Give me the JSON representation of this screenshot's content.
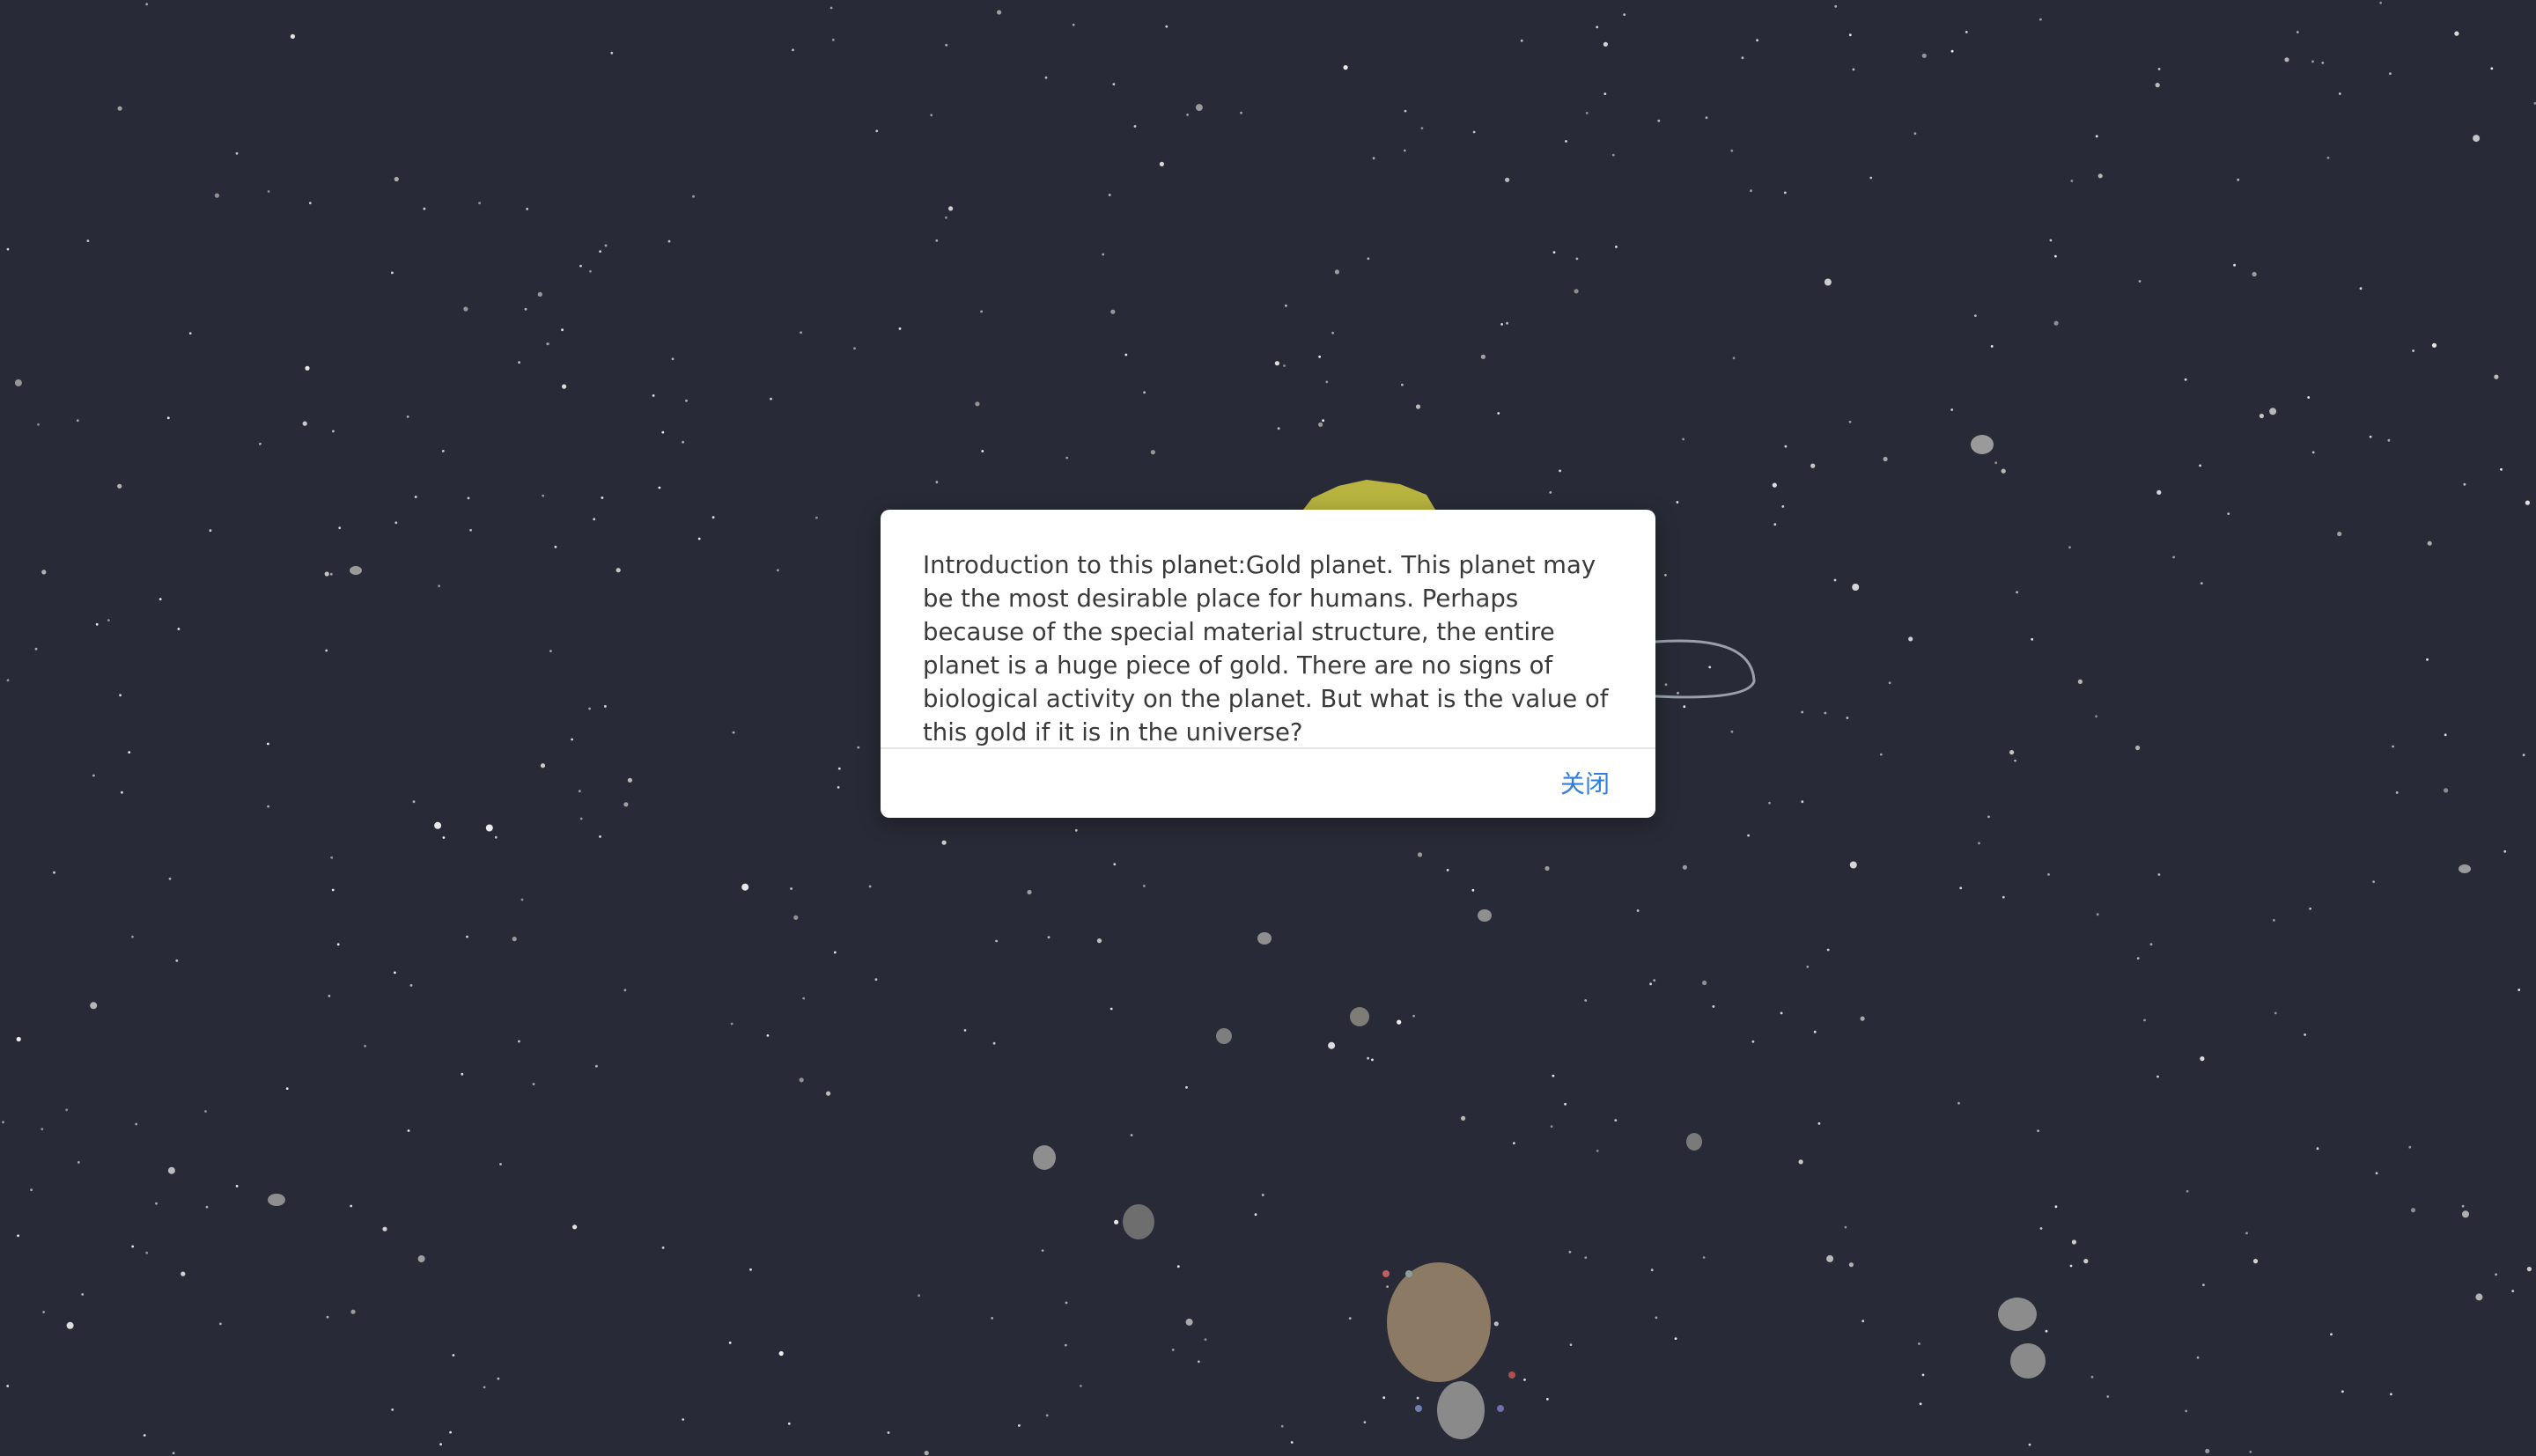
{
  "dialog": {
    "body_text": "Introduction to this planet:Gold planet. This planet may be the most desirable place for humans. Perhaps because of the special material structure, the entire planet is a huge piece of gold. There are no signs of biological activity on the planet. But what is the value of this gold if it is in the universe?",
    "close_label": "关闭"
  },
  "colors": {
    "space_background": "#282b37",
    "gold_planet": "#b8b43f",
    "orbit_line": "#9aa0aa",
    "brown_planet": "#8d7a64",
    "link_accent": "#2f7fe0"
  }
}
